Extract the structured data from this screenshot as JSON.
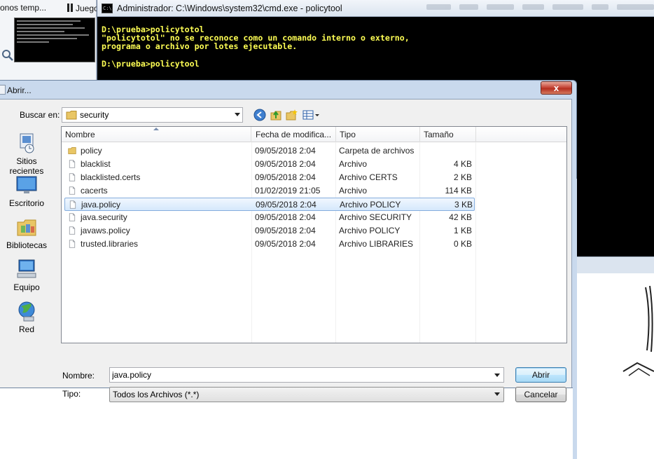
{
  "background": {
    "tabs": [
      "onos temp...",
      "Juego"
    ],
    "cmd": {
      "title": "Administrador: C:\\Windows\\system32\\cmd.exe - policytool",
      "icon_label": "C:\\",
      "lines": [
        "D:\\prueba>policytotol",
        "\"policytotol\" no se reconoce como un comando interno o externo,",
        "programa o archivo por lotes ejecutable.",
        "",
        "D:\\prueba>policytool"
      ]
    }
  },
  "dialog": {
    "title": "Abrir...",
    "close_label": "x",
    "look_in_label": "Buscar en:",
    "look_in_value": "security",
    "places": [
      {
        "label": "Sitios recientes",
        "icon": "recent-places-icon"
      },
      {
        "label": "Escritorio",
        "icon": "desktop-icon"
      },
      {
        "label": "Bibliotecas",
        "icon": "libraries-icon"
      },
      {
        "label": "Equipo",
        "icon": "computer-icon"
      },
      {
        "label": "Red",
        "icon": "network-icon"
      }
    ],
    "columns": {
      "name": "Nombre",
      "date": "Fecha de modifica...",
      "type": "Tipo",
      "size": "Tamaño"
    },
    "files": [
      {
        "name": "policy",
        "date": "09/05/2018 2:04",
        "type": "Carpeta de archivos",
        "size": "",
        "icon": "folder-icon"
      },
      {
        "name": "blacklist",
        "date": "09/05/2018 2:04",
        "type": "Archivo",
        "size": "4 KB",
        "icon": "file-icon"
      },
      {
        "name": "blacklisted.certs",
        "date": "09/05/2018 2:04",
        "type": "Archivo CERTS",
        "size": "2 KB",
        "icon": "file-icon"
      },
      {
        "name": "cacerts",
        "date": "01/02/2019 21:05",
        "type": "Archivo",
        "size": "114 KB",
        "icon": "file-icon"
      },
      {
        "name": "java.policy",
        "date": "09/05/2018 2:04",
        "type": "Archivo POLICY",
        "size": "3 KB",
        "icon": "file-icon"
      },
      {
        "name": "java.security",
        "date": "09/05/2018 2:04",
        "type": "Archivo SECURITY",
        "size": "42 KB",
        "icon": "file-icon"
      },
      {
        "name": "javaws.policy",
        "date": "09/05/2018 2:04",
        "type": "Archivo POLICY",
        "size": "1 KB",
        "icon": "file-icon"
      },
      {
        "name": "trusted.libraries",
        "date": "09/05/2018 2:04",
        "type": "Archivo LIBRARIES",
        "size": "0 KB",
        "icon": "file-icon"
      }
    ],
    "selected_file": "java.policy",
    "file_name_label": "Nombre:",
    "file_name_value": "java.policy",
    "file_type_label": "Tipo:",
    "file_type_value": "Todos los Archivos (*.*)",
    "open_button": "Abrir",
    "cancel_button": "Cancelar"
  }
}
